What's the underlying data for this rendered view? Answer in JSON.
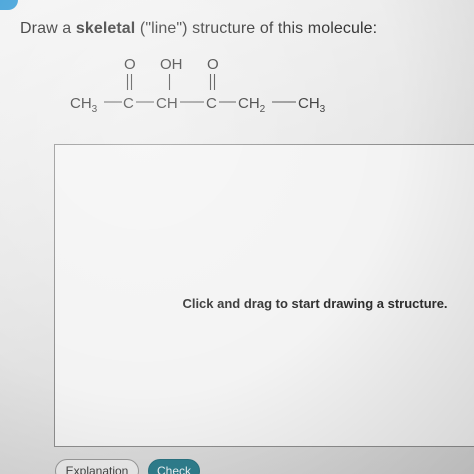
{
  "instruction": {
    "prefix": "Draw a ",
    "emphasis": "skeletal",
    "suffix": " (\"line\") structure of this molecule:"
  },
  "molecule": {
    "top_o1": "O",
    "top_oh": "OH",
    "top_o2": "O",
    "ch3_left": "CH",
    "ch3_left_sub": "3",
    "c1": "C",
    "ch": "CH",
    "c2": "C",
    "ch2": "CH",
    "ch2_sub": "2",
    "ch3_right": "CH",
    "ch3_right_sub": "3"
  },
  "canvas": {
    "hint": "Click and drag to start drawing a structure."
  },
  "buttons": {
    "explanation": "Explanation",
    "check": "Check"
  },
  "colors": {
    "check_button": "#2f7f8e",
    "corner_badge": "#3d9fd8"
  }
}
